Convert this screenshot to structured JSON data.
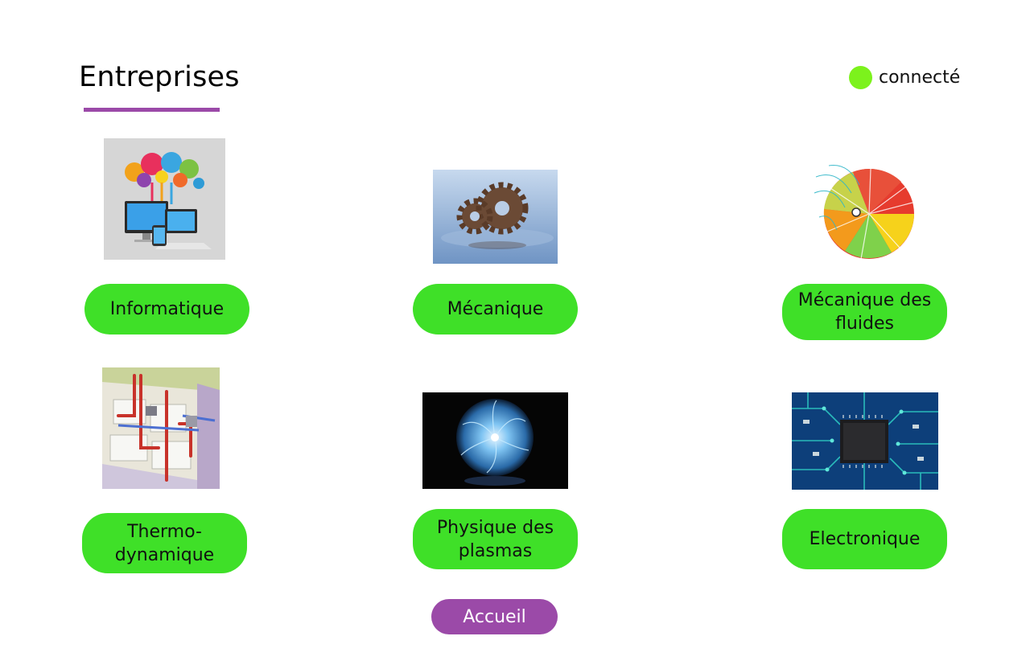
{
  "header": {
    "title": "Entreprises",
    "status_label": "connecté",
    "status_color": "#7cf21c"
  },
  "colors": {
    "category_button": "#3fe028",
    "accent": "#9b4aa8"
  },
  "categories": [
    {
      "label": "Informatique",
      "image": "computer-devices-cloud-image"
    },
    {
      "label": "Mécanique",
      "image": "gears-image"
    },
    {
      "label": "Mécanique des fluides",
      "image": "fluid-turbine-simulation-image"
    },
    {
      "label": "Thermo-\ndynamique",
      "image": "building-heating-ducts-image"
    },
    {
      "label": "Physique des plasmas",
      "image": "plasma-ball-image"
    },
    {
      "label": "Electronique",
      "image": "circuit-board-chip-image"
    }
  ],
  "footer": {
    "home_label": "Accueil"
  }
}
